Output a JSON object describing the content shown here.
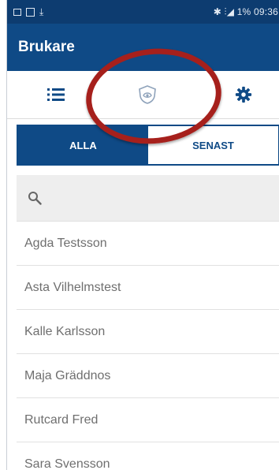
{
  "status_bar": {
    "right_text": "1% 09:36",
    "icons": [
      "screenshot-icon",
      "image-icon",
      "download-icon",
      "bluetooth-icon",
      "signal-icon"
    ]
  },
  "app_bar": {
    "title": "Brukare"
  },
  "tabs": [
    {
      "icon": "list-icon"
    },
    {
      "icon": "guard-shield-icon"
    },
    {
      "icon": "gear-icon"
    }
  ],
  "segment": {
    "all_label": "ALLA",
    "recent_label": "SENAST",
    "selected": "ALLA"
  },
  "search": {
    "placeholder": "",
    "value": ""
  },
  "users": [
    {
      "name": "Agda Testsson"
    },
    {
      "name": "Asta Vilhelmstest"
    },
    {
      "name": "Kalle Karlsson"
    },
    {
      "name": "Maja Gräddnos"
    },
    {
      "name": "Rutcard Fred"
    },
    {
      "name": "Sara Svensson"
    }
  ],
  "colors": {
    "status_bar": "#0d3c70",
    "app_bar": "#0f4a86",
    "accent": "#0f4a86",
    "annotation": "#a6201c",
    "search_bg": "#eeeeee"
  }
}
